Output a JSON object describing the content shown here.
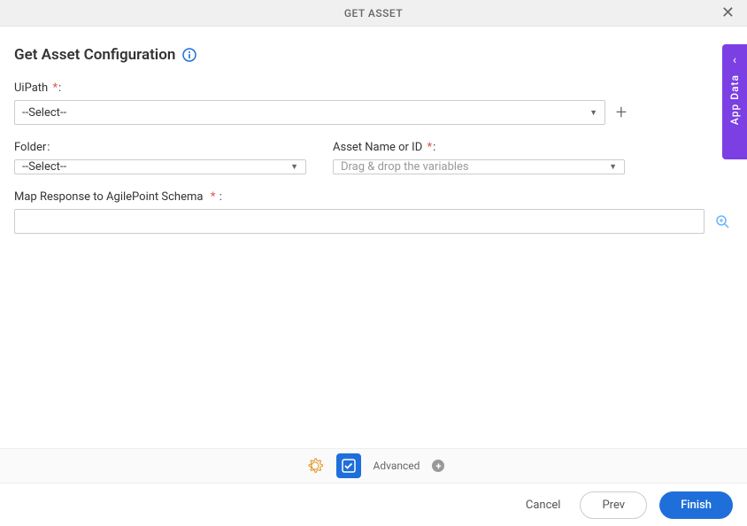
{
  "header": {
    "title": "GET ASSET"
  },
  "page": {
    "title": "Get Asset Configuration"
  },
  "fields": {
    "uipath": {
      "label": "UiPath",
      "value": "--Select--"
    },
    "folder": {
      "label": "Folder",
      "value": "--Select--"
    },
    "assetName": {
      "label": "Asset Name or ID",
      "placeholder": "Drag & drop the variables"
    },
    "mapResponse": {
      "label": "Map Response to AgilePoint Schema",
      "value": ""
    }
  },
  "toolbar": {
    "advanced": "Advanced"
  },
  "footer": {
    "cancel": "Cancel",
    "prev": "Prev",
    "finish": "Finish"
  },
  "side": {
    "label": "App Data"
  }
}
